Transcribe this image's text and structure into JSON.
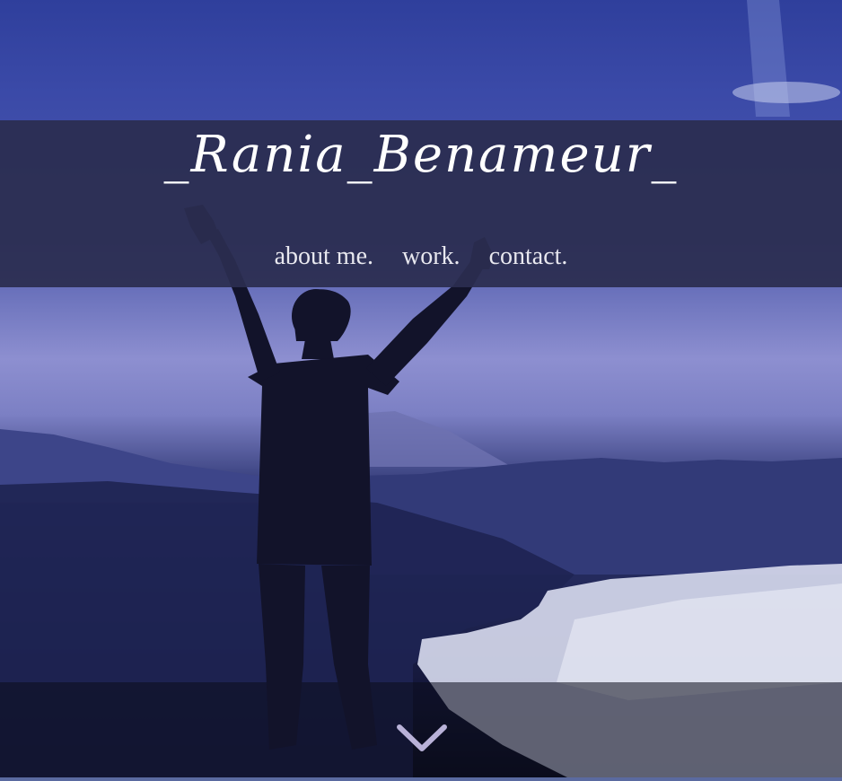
{
  "header": {
    "title": "_Rania_Benameur_"
  },
  "nav": {
    "items": [
      {
        "label": "about me."
      },
      {
        "label": "work."
      },
      {
        "label": "contact."
      }
    ]
  },
  "hero": {
    "scroll_icon": "chevron-down-icon"
  },
  "colors": {
    "sky": "#3b4aa8",
    "banner": "#2b2d50",
    "text": "#ffffff",
    "arrow": "#b9b2d8"
  }
}
